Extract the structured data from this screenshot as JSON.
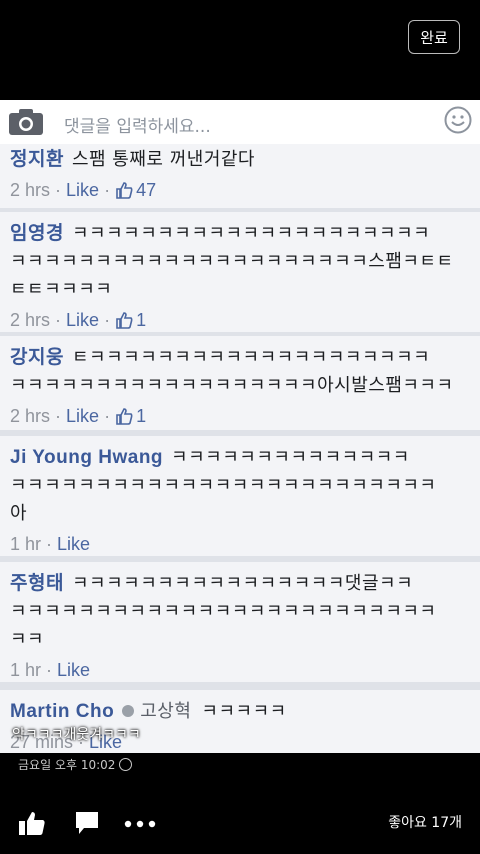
{
  "top": {
    "done_label": "완료"
  },
  "composer": {
    "placeholder": "댓글을 입력하세요..."
  },
  "comments": [
    {
      "author": "정지환",
      "lines": [
        "스팸 통째로 꺼낸거같다"
      ],
      "time": "2 hrs",
      "like": "Like",
      "likes": "47"
    },
    {
      "author": "임영경",
      "lines": [
        "ㅋㅋㅋㅋㅋㅋㅋㅋㅋㅋㅋㅋㅋㅋㅋㅋㅋㅋㅋㅋㅋ",
        "ㅋㅋㅋㅋㅋㅋㅋㅋㅋㅋㅋㅋㅋㅋㅋㅋㅋㅋㅋㅋㅋ스팸ㅋㅌㅌ",
        "ㅌㅌㅋㅋㅋㅋ"
      ],
      "time": "2 hrs",
      "like": "Like",
      "likes": "1"
    },
    {
      "author": "강지웅",
      "lines": [
        "ㅌㅋㅋㅋㅋㅋㅋㅋㅋㅋㅋㅋㅋㅋㅋㅋㅋㅋㅋㅋㅋ",
        "ㅋㅋㅋㅋㅋㅋㅋㅋㅋㅋㅋㅋㅋㅋㅋㅋㅋㅋ아시발스팸ㅋㅋㅋ"
      ],
      "time": "2 hrs",
      "like": "Like",
      "likes": "1"
    },
    {
      "author": "Ji Young Hwang",
      "lines": [
        "ㅋㅋㅋㅋㅋㅋㅋㅋㅋㅋㅋㅋㅋㅋ",
        "ㅋㅋㅋㅋㅋㅋㅋㅋㅋㅋㅋㅋㅋㅋㅋㅋㅋㅋㅋㅋㅋㅋㅋㅋㅋ",
        "아"
      ],
      "time": "1 hr",
      "like": "Like"
    },
    {
      "author": "주형태",
      "lines": [
        "ㅋㅋㅋㅋㅋㅋㅋㅋㅋㅋㅋㅋㅋㅋㅋㅋ댓글ㅋㅋ",
        "ㅋㅋㅋㅋㅋㅋㅋㅋㅋㅋㅋㅋㅋㅋㅋㅋㅋㅋㅋㅋㅋㅋㅋㅋㅋ",
        "ㅋㅋ"
      ],
      "time": "1 hr",
      "like": "Like"
    },
    {
      "author": "Martin Cho",
      "tag": "고상혁",
      "lines": [
        "ㅋㅋㅋㅋㅋ"
      ],
      "time": "27 mins",
      "like": "Like"
    }
  ],
  "caption": "악ㅋㅋㅋ개웃겨ㅋㅋㅋ",
  "post_date": "금요일 오후 10:02",
  "footer": {
    "likes_text": "좋아요 17개"
  },
  "icons": [
    "camera-icon",
    "smiley-icon",
    "thumbs-up-icon",
    "comment-icon",
    "more-icon",
    "globe-icon"
  ]
}
